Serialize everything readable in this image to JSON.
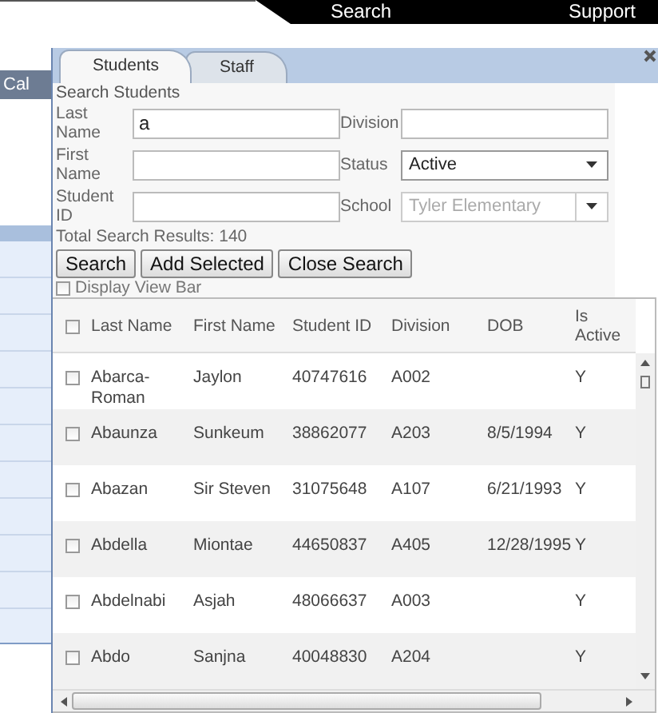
{
  "background": {
    "nav_links": [
      "Search",
      "Support"
    ],
    "side_tab": "Cal"
  },
  "dialog": {
    "tabs": [
      {
        "label": "Students",
        "selected": true
      },
      {
        "label": "Staff",
        "selected": false
      }
    ],
    "heading": "Search Students",
    "fields": [
      {
        "kind": "text",
        "label": "Last Name",
        "value": "a"
      },
      {
        "kind": "text",
        "label": "Division"
      },
      {
        "kind": "text",
        "label": "First Name"
      },
      {
        "kind": "select",
        "label": "Status",
        "value": "Active",
        "disabled": false
      },
      {
        "kind": "text",
        "label": "Student ID"
      },
      {
        "kind": "select",
        "label": "School",
        "value": "Tyler Elementary",
        "disabled": true
      }
    ],
    "results_count": "Total Search Results: 140",
    "buttons": [
      "Search",
      "Add Selected",
      "Close Search"
    ],
    "view_bar": {
      "label": "Display View Bar",
      "checked": false
    },
    "table": {
      "all_checked": false,
      "columns": [
        "Last Name",
        "First Name",
        "Student ID",
        "Division",
        "DOB",
        "Is Active"
      ],
      "rows": [
        {
          "checked": false,
          "cells": [
            "Abarca-Roman",
            "Jaylon",
            "40747616",
            "A002",
            "",
            "Y"
          ]
        },
        {
          "checked": false,
          "cells": [
            "Abaunza",
            "Sunkeum",
            "38862077",
            "A203",
            "8/5/1994",
            "Y"
          ]
        },
        {
          "checked": false,
          "cells": [
            "Abazan",
            "Sir Steven",
            "31075648",
            "A107",
            "6/21/1993",
            "Y"
          ]
        },
        {
          "checked": false,
          "cells": [
            "Abdella",
            "Miontae",
            "44650837",
            "A405",
            "12/28/1995",
            "Y"
          ]
        },
        {
          "checked": false,
          "cells": [
            "Abdelnabi",
            "Asjah",
            "48066637",
            "A003",
            "",
            "Y"
          ]
        },
        {
          "checked": false,
          "cells": [
            "Abdo",
            "Sanjna",
            "40048830",
            "A204",
            "",
            "Y"
          ]
        }
      ]
    }
  }
}
